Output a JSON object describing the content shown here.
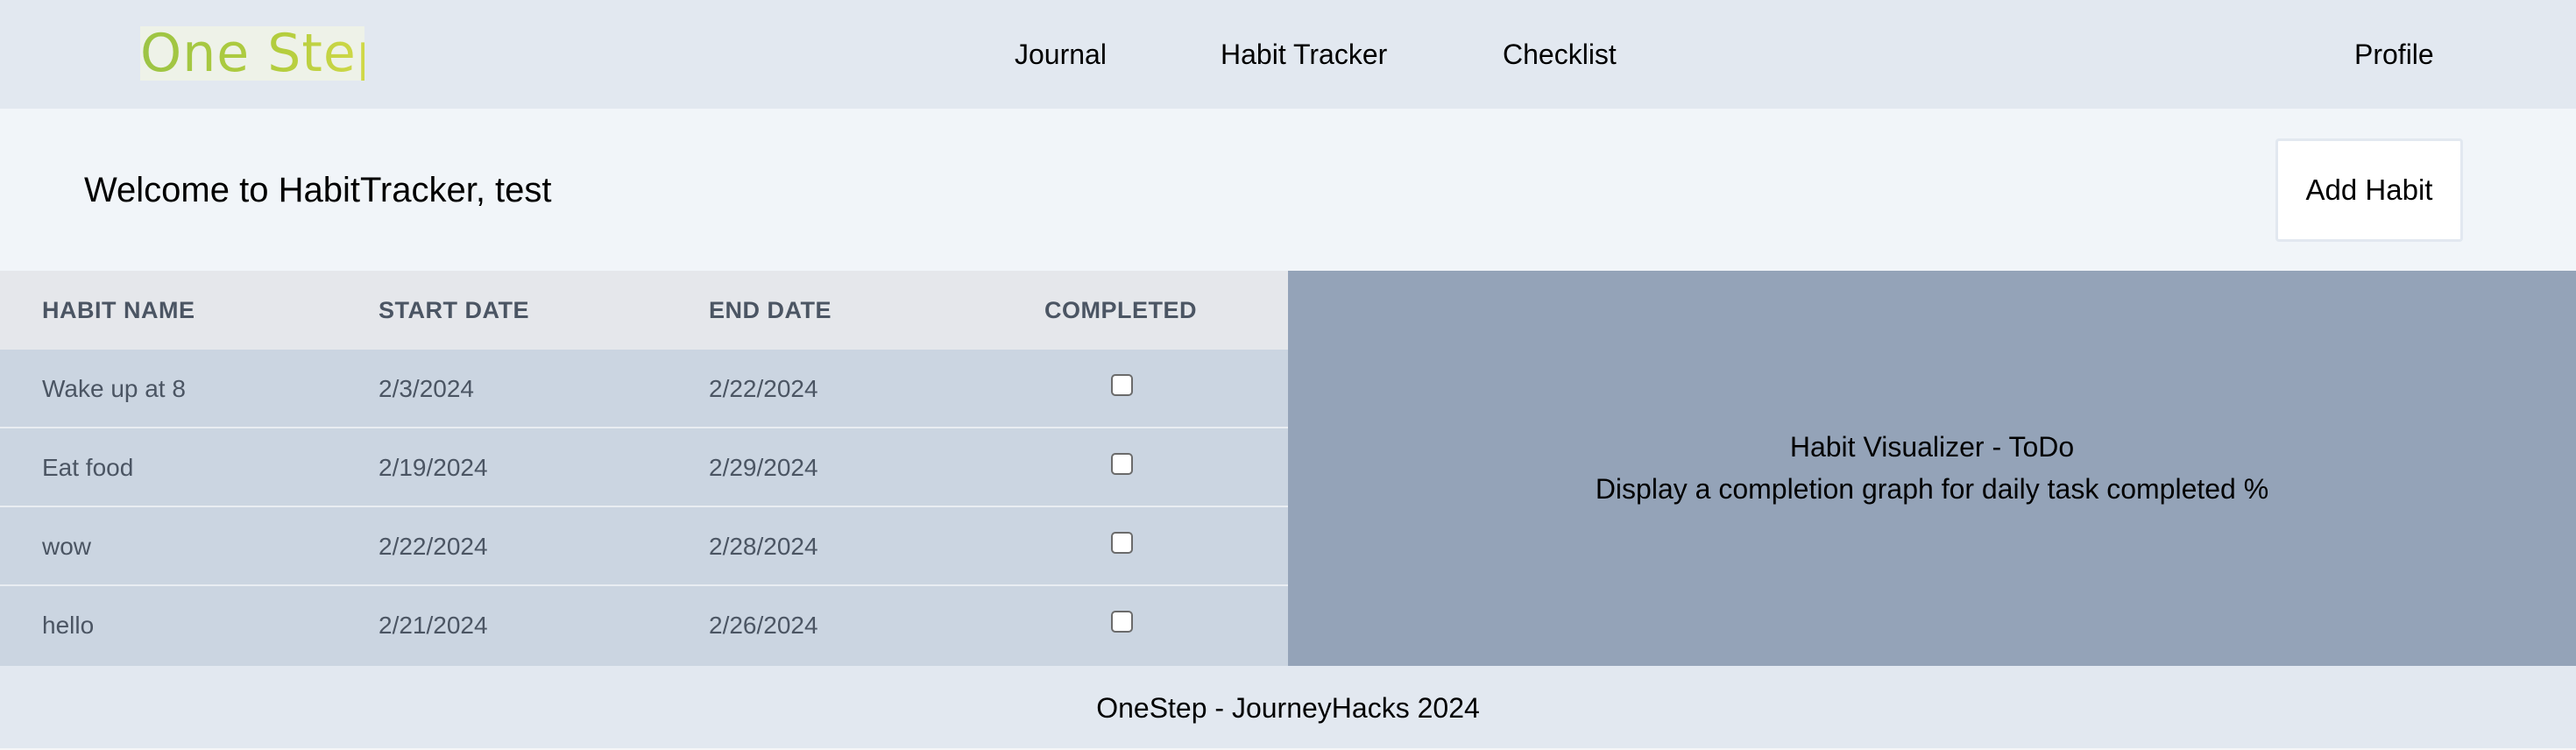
{
  "nav": {
    "logo": "One Step",
    "links": [
      "Journal",
      "Habit Tracker",
      "Checklist"
    ],
    "profile": "Profile"
  },
  "header": {
    "welcome": "Welcome to HabitTracker, test",
    "add_button": "Add Habit"
  },
  "table": {
    "columns": [
      "HABIT NAME",
      "START DATE",
      "END DATE",
      "COMPLETED"
    ],
    "rows": [
      {
        "name": "Wake up at 8",
        "start": "2/3/2024",
        "end": "2/22/2024",
        "completed": false
      },
      {
        "name": "Eat food",
        "start": "2/19/2024",
        "end": "2/29/2024",
        "completed": false
      },
      {
        "name": "wow",
        "start": "2/22/2024",
        "end": "2/28/2024",
        "completed": false
      },
      {
        "name": "hello",
        "start": "2/21/2024",
        "end": "2/26/2024",
        "completed": false
      }
    ]
  },
  "visualizer": {
    "title": "Habit Visualizer - ToDo",
    "subtitle": "Display a completion graph for daily task completed %"
  },
  "footer": {
    "text": "OneStep - JourneyHacks 2024"
  },
  "colors": {
    "page_bg": "#e2e8f0",
    "band_bg": "#f1f5f9",
    "table_header_bg": "#e5e7eb",
    "row_bg": "#cbd5e1",
    "visualizer_bg": "#94a3b8",
    "logo_green": "#9cc444"
  }
}
